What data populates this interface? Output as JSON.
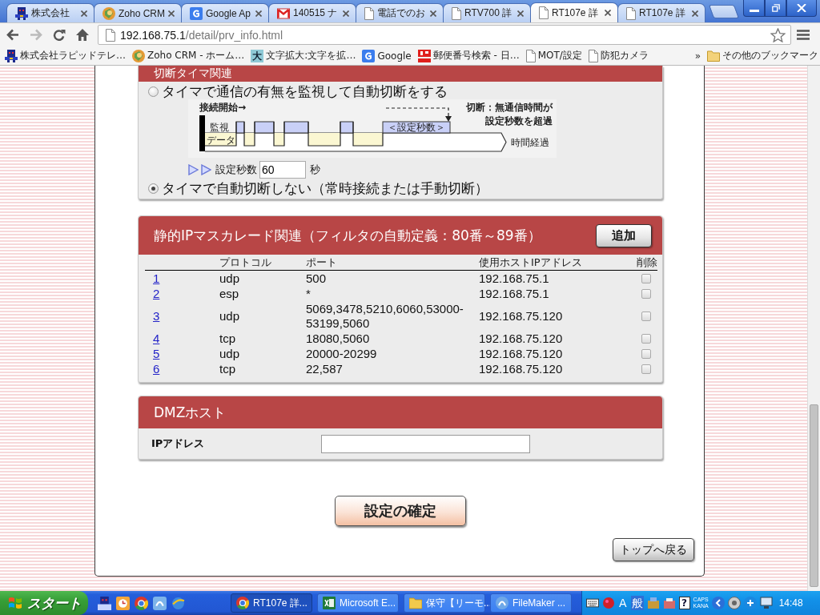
{
  "browser": {
    "tabs": [
      {
        "title": "株式会社",
        "selected": false
      },
      {
        "title": "Zoho CRM",
        "selected": false
      },
      {
        "title": "Google Ap",
        "selected": false
      },
      {
        "title": "140515 ナ",
        "selected": false
      },
      {
        "title": "電話でのお",
        "selected": false
      },
      {
        "title": "RTV700 詳",
        "selected": false
      },
      {
        "title": "RT107e 詳",
        "selected": true
      },
      {
        "title": "RT107e 詳",
        "selected": false
      }
    ],
    "address": {
      "host": "192.168.75.1",
      "path": "/detail/prv_info.html"
    },
    "bookmarks": [
      {
        "label": "株式会社ラピッドテレ…"
      },
      {
        "label": "Zoho CRM - ホーム…"
      },
      {
        "icon_text": "大",
        "label": "文字拡大:文字を拡…"
      },
      {
        "label": "Google"
      },
      {
        "label": "郵便番号検索 - 日…"
      },
      {
        "label": "MOT/設定"
      },
      {
        "label": "防犯カメラ"
      }
    ],
    "bookmarks_overflow": "»",
    "other_bookmarks": "その他のブックマーク"
  },
  "timer_section": {
    "title": "切断タイマ関連",
    "options": [
      {
        "label": "タイマで通信の有無を監視して自動切断をする",
        "selected": false
      },
      {
        "label": "タイマで自動切断しない（常時接続または手動切断）",
        "selected": true
      }
    ],
    "diagram": {
      "start_label": "接続開始→",
      "monitor_label": "監視",
      "data_label": "データ",
      "period_label": "＜設定秒数＞",
      "cutoff_note": [
        "切断：無通信時間が",
        "設定秒数を超過"
      ],
      "time_label": "時間経過"
    },
    "seconds": {
      "label": "設定秒数",
      "value": "60",
      "unit": "秒"
    }
  },
  "masquerade_section": {
    "title": "静的IPマスカレード関連（フィルタの自動定義：80番～89番）",
    "add_button": "追加",
    "columns": [
      "プロトコル",
      "ポート",
      "使用ホストIPアドレス",
      "削除"
    ],
    "rows": [
      {
        "number": "1",
        "protocol": "udp",
        "port": "500",
        "host": "192.168.75.1",
        "delete": false
      },
      {
        "number": "2",
        "protocol": "esp",
        "port": "*",
        "host": "192.168.75.1",
        "delete": false
      },
      {
        "number": "3",
        "protocol": "udp",
        "port": "5069,3478,5210,6060,53000-53199,5060",
        "host": "192.168.75.120",
        "delete": false
      },
      {
        "number": "4",
        "protocol": "tcp",
        "port": "18080,5060",
        "host": "192.168.75.120",
        "delete": false
      },
      {
        "number": "5",
        "protocol": "udp",
        "port": "20000-20299",
        "host": "192.168.75.120",
        "delete": false
      },
      {
        "number": "6",
        "protocol": "tcp",
        "port": "22,587",
        "host": "192.168.75.120",
        "delete": false
      }
    ]
  },
  "dmz_section": {
    "title": "DMZホスト",
    "field_label": "IPアドレス"
  },
  "confirm_button": "設定の確定",
  "back_button": "トップへ戻る",
  "taskbar": {
    "start": "スタート",
    "tasks": [
      {
        "label": "RT107e 詳...",
        "selected": true
      },
      {
        "label": "Microsoft E...",
        "selected": false
      },
      {
        "label": "保守【リーモ...",
        "selected": false
      },
      {
        "label": "FileMaker ...",
        "selected": false
      }
    ],
    "ime": [
      "A",
      "般"
    ],
    "help": "?",
    "caps": "CAPS",
    "kana": "KANA",
    "clock": "14:48"
  }
}
